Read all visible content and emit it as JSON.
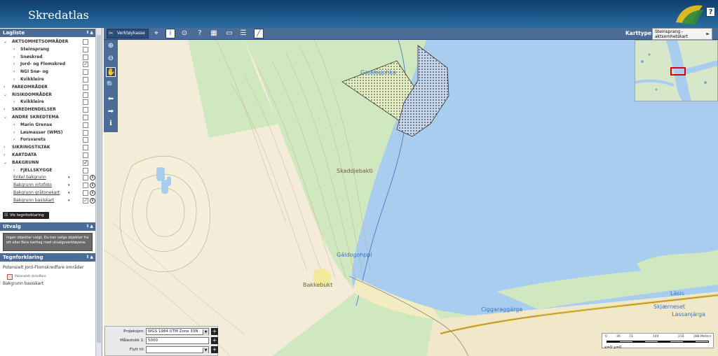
{
  "header": {
    "title": "Skredatlas",
    "help": "?"
  },
  "toolbar": {
    "toolbox_label": "Verktøykasse",
    "karttype_label": "Karttype:",
    "karttype_value": "Steinsprang - aktsomhetskart"
  },
  "layers_panel": {
    "title": "Lagliste",
    "items": [
      {
        "label": "AKTSOMHETSOMRÅDER",
        "level": 0,
        "expanded": true,
        "checked": false
      },
      {
        "label": "Steinsprang",
        "level": 1,
        "checked": false
      },
      {
        "label": "Snøskred",
        "level": 1,
        "checked": false
      },
      {
        "label": "Jord- og Flomskred",
        "level": 1,
        "checked": true
      },
      {
        "label": "NGI Snø- og",
        "level": 1,
        "checked": false
      },
      {
        "label": "Kvikkleire",
        "level": 1,
        "checked": false
      },
      {
        "label": "FAREOMRÅDER",
        "level": 0,
        "expanded": false,
        "checked": false
      },
      {
        "label": "RISIKOOMRÅDER",
        "level": 0,
        "expanded": true,
        "checked": false
      },
      {
        "label": "Kvikkleire",
        "level": 1,
        "checked": false
      },
      {
        "label": "SKREDHENDELSER",
        "level": 0,
        "expanded": false,
        "checked": false
      },
      {
        "label": "ANDRE SKREDTEMA",
        "level": 0,
        "expanded": true,
        "checked": false
      },
      {
        "label": "Marin Grense",
        "level": 1,
        "checked": false
      },
      {
        "label": "Løsmasser (WMS)",
        "level": 1,
        "checked": false
      },
      {
        "label": "Forsvarets",
        "level": 1,
        "checked": false
      },
      {
        "label": "SIKRINGSTILTAK",
        "level": 0,
        "expanded": false,
        "checked": false
      },
      {
        "label": "KARTDATA",
        "level": 0,
        "expanded": false,
        "checked": false
      },
      {
        "label": "BAKGRUNN",
        "level": 0,
        "expanded": true,
        "checked": true
      },
      {
        "label": "FJELLSKYGGE",
        "level": 1,
        "checked": false
      },
      {
        "label": "Enkel bakgrunn",
        "level": 1,
        "link": true,
        "checked": false
      },
      {
        "label": "Bakgrunn ortofoto",
        "level": 1,
        "link": true,
        "checked": false
      },
      {
        "label": "Bakgrunn gråtonekart",
        "level": 1,
        "link": true,
        "checked": false
      },
      {
        "label": "Bakgrunn basiskart",
        "level": 1,
        "link": true,
        "checked": true
      }
    ],
    "legend_button": "Vis tegnforklaring"
  },
  "selection_panel": {
    "title": "Utvalg",
    "message": "Ingen objekter valgt. Du kan velge objekter fra ett eller flere kartlag med utvalgsverktøyene."
  },
  "legend_panel": {
    "title": "Tegnforklaring",
    "items": [
      "Potensielt Jord-Flomskredfare områder",
      "Potensielt skredfare",
      "Bakgrunn basiskart"
    ]
  },
  "map": {
    "place_labels": [
      "Gaskkajohka",
      "Skaddjebakti",
      "Gáldogohppi",
      "Bakkebukt",
      "Ciggaraggárga",
      "Lásis",
      "Skjærneset",
      "Lassanjárga"
    ]
  },
  "bottom_form": {
    "projection_label": "Projeksjon:",
    "projection_value": "WGS 1984 UTM Zone 33N",
    "scale_label": "Målestokk 1:",
    "scale_value": "5000",
    "move_label": "Flytt til:",
    "move_value": ""
  },
  "scalebar": {
    "ticks": [
      "0",
      "36",
      "72",
      "144",
      "216",
      "288 Meters"
    ]
  },
  "coords": "x=0 y=0",
  "colors": {
    "header": "#1f5a8e",
    "toolbar": "#4c6c98",
    "water": "#a8cdee",
    "land": "#cfe8c0"
  }
}
